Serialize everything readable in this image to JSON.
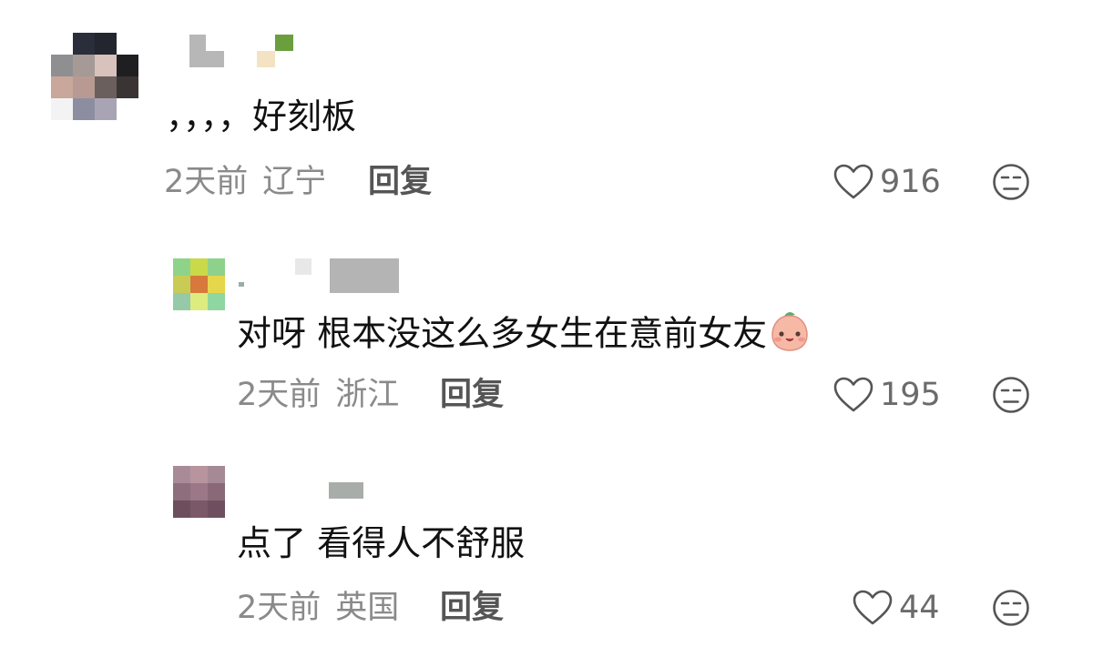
{
  "comments": [
    {
      "text": "，，，，好刻板",
      "time": "2天前",
      "location": "辽宁",
      "reply_label": "回复",
      "likes": "916",
      "is_reply": false
    },
    {
      "text": "对呀 根本没这么多女生在意前女友",
      "emoji": "smiling-peach-emoji",
      "time": "2天前",
      "location": "浙江",
      "reply_label": "回复",
      "likes": "195",
      "is_reply": true
    },
    {
      "text": "点了 看得人不舒服",
      "time": "2天前",
      "location": "英国",
      "reply_label": "回复",
      "likes": "44",
      "is_reply": true
    }
  ],
  "icons": {
    "like": "heart-outline-icon",
    "dislike": "unamused-face-icon"
  },
  "colors": {
    "text": "#111111",
    "meta": "#8a8a8a",
    "reply": "#555555",
    "icon": "#555555"
  }
}
